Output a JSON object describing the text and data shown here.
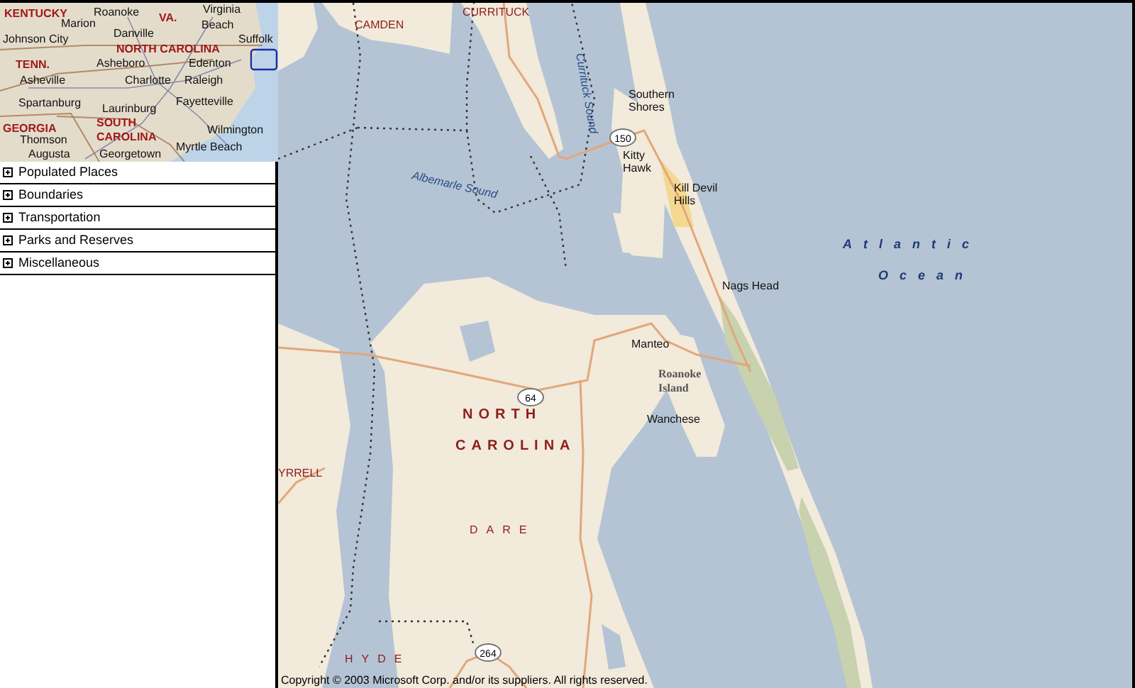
{
  "overview_map": {
    "labels": [
      {
        "lines": [
          "KENTUCKY"
        ],
        "kind": "state"
      },
      {
        "lines": [
          "Roanoke"
        ],
        "kind": "city"
      },
      {
        "lines": [
          "VA."
        ],
        "kind": "state"
      },
      {
        "lines": [
          "Virginia"
        ],
        "kind": "city"
      },
      {
        "lines": [
          "Marion"
        ],
        "kind": "city"
      },
      {
        "lines": [
          "Beach"
        ],
        "kind": "city"
      },
      {
        "lines": [
          "Johnson City"
        ],
        "kind": "city"
      },
      {
        "lines": [
          "Danville"
        ],
        "kind": "city"
      },
      {
        "lines": [
          "Suffolk"
        ],
        "kind": "city"
      },
      {
        "lines": [
          "NORTH CAROLINA"
        ],
        "kind": "state"
      },
      {
        "lines": [
          "TENN."
        ],
        "kind": "state"
      },
      {
        "lines": [
          "Asheboro"
        ],
        "kind": "city"
      },
      {
        "lines": [
          "Edenton"
        ],
        "kind": "city"
      },
      {
        "lines": [
          "Asheville"
        ],
        "kind": "city"
      },
      {
        "lines": [
          "Charlotte"
        ],
        "kind": "city"
      },
      {
        "lines": [
          "Raleigh"
        ],
        "kind": "city"
      },
      {
        "lines": [
          "Spartanburg"
        ],
        "kind": "city"
      },
      {
        "lines": [
          "Laurinburg"
        ],
        "kind": "city"
      },
      {
        "lines": [
          "Fayetteville"
        ],
        "kind": "city"
      },
      {
        "lines": [
          "GEORGIA"
        ],
        "kind": "state"
      },
      {
        "lines": [
          "SOUTH",
          "CAROLINA"
        ],
        "kind": "state"
      },
      {
        "lines": [
          "Wilmington"
        ],
        "kind": "city"
      },
      {
        "lines": [
          "Thomson"
        ],
        "kind": "city"
      },
      {
        "lines": [
          "Myrtle Beach"
        ],
        "kind": "city"
      },
      {
        "lines": [
          "Augusta"
        ],
        "kind": "city"
      },
      {
        "lines": [
          "Georgetown"
        ],
        "kind": "city"
      }
    ]
  },
  "layers": [
    {
      "label": "Populated Places"
    },
    {
      "label": "Boundaries"
    },
    {
      "label": "Transportation"
    },
    {
      "label": "Parks and Reserves"
    },
    {
      "label": "Miscellaneous"
    }
  ],
  "map": {
    "labels": [
      {
        "lines": [
          "CAMDEN"
        ],
        "kind": "county"
      },
      {
        "lines": [
          "CURRITUCK"
        ],
        "kind": "county"
      },
      {
        "lines": [
          "Currituck Sound"
        ],
        "kind": "water"
      },
      {
        "lines": [
          "Southern",
          "Shores"
        ],
        "kind": "place"
      },
      {
        "lines": [
          "Kitty",
          "Hawk"
        ],
        "kind": "place"
      },
      {
        "lines": [
          "Kill Devil",
          "Hills"
        ],
        "kind": "place"
      },
      {
        "lines": [
          "Albemarle Sound"
        ],
        "kind": "water"
      },
      {
        "lines": [
          "Atlantic",
          "Ocean"
        ],
        "kind": "ocean"
      },
      {
        "lines": [
          "Nags Head"
        ],
        "kind": "place"
      },
      {
        "lines": [
          "Manteo"
        ],
        "kind": "place"
      },
      {
        "lines": [
          "Roanoke",
          "Island"
        ],
        "kind": "island"
      },
      {
        "lines": [
          "Wanchese"
        ],
        "kind": "place"
      },
      {
        "lines": [
          "NORTH",
          "CAROLINA"
        ],
        "kind": "state"
      },
      {
        "lines": [
          "YRRELL"
        ],
        "kind": "county"
      },
      {
        "lines": [
          "DARE"
        ],
        "kind": "county"
      },
      {
        "lines": [
          "HYDE"
        ],
        "kind": "county"
      }
    ],
    "route_shields": [
      "150",
      "64",
      "264"
    ],
    "copyright": "Copyright © 2003 Microsoft Corp. and/or its suppliers. All rights reserved."
  }
}
